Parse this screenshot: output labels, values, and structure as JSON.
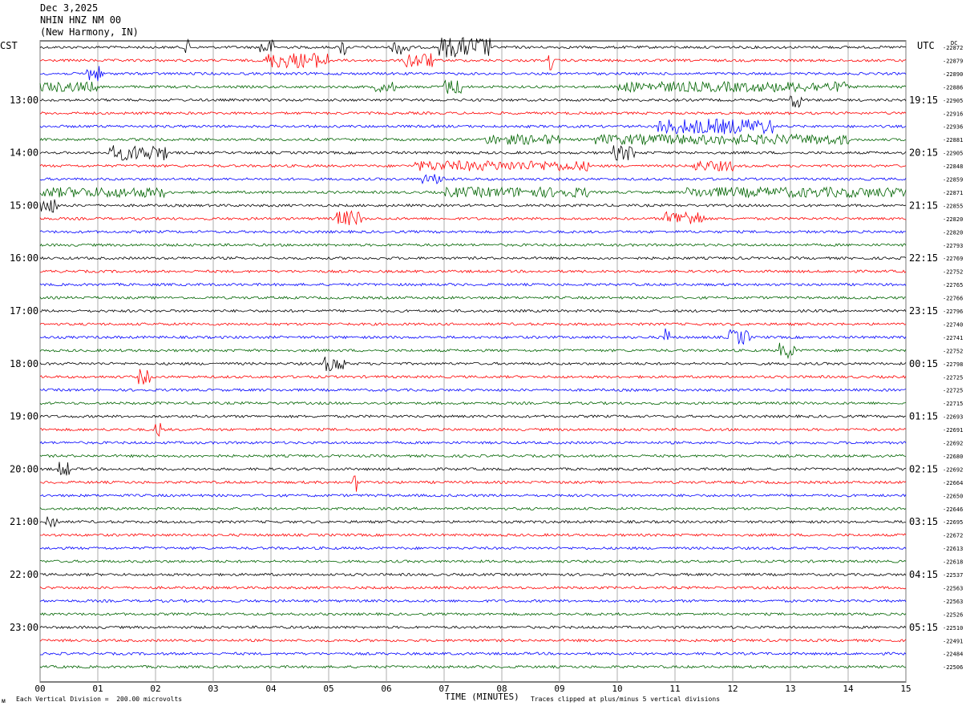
{
  "header": {
    "date": "Dec 3,2025",
    "station": "NHIN HNZ NM 00",
    "location": "(New Harmony, IN)"
  },
  "left_tz": "CST",
  "right_tz": "UTC",
  "footer": {
    "scale_note": "Each Vertical Division =  200.00 microvolts",
    "clip_note": "Traces clipped at plus/minus 5 vertical divisions",
    "corner_mark": "ᴍ"
  },
  "colors": [
    "#000000",
    "#ff0000",
    "#0000ff",
    "#006400"
  ],
  "chart_data": {
    "type": "line",
    "xlabel": "TIME (MINUTES)",
    "xlim": [
      0,
      15
    ],
    "x_ticks": [
      "00",
      "01",
      "02",
      "03",
      "04",
      "05",
      "06",
      "07",
      "08",
      "09",
      "10",
      "11",
      "12",
      "13",
      "14",
      "15"
    ],
    "left_hour_labels": [
      "13:00",
      "14:00",
      "15:00",
      "16:00",
      "17:00",
      "18:00",
      "19:00",
      "20:00",
      "21:00",
      "22:00",
      "23:00"
    ],
    "right_hour_labels": [
      "19:15",
      "20:15",
      "21:15",
      "22:15",
      "23:15",
      "00:15",
      "01:15",
      "02:15",
      "03:15",
      "04:15",
      "05:15"
    ],
    "trace_count": 48,
    "right_dc_header": "DC",
    "right_dc_values": [
      "-22872",
      "-22879",
      "-22890",
      "-22886",
      "-22905",
      "-22916",
      "-22936",
      "-22881",
      "-22905",
      "-22848",
      "-22859",
      "-22871",
      "-22855",
      "-22820",
      "-22820",
      "-22793",
      "-22769",
      "-22752",
      "-22765",
      "-22766",
      "-22796",
      "-22740",
      "-22741",
      "-22752",
      "-22798",
      "-22725",
      "-22725",
      "-22715",
      "-22693",
      "-22691",
      "-22692",
      "-22680",
      "-22692",
      "-22664",
      "-22650",
      "-22646",
      "-22695",
      "-22672",
      "-22613",
      "-22618",
      "-22537",
      "-22563",
      "-22563",
      "-22526",
      "-22510",
      "-22491",
      "-22484",
      "-22506"
    ],
    "events": [
      {
        "trace": 0,
        "x": [
          3.8,
          4.1
        ],
        "amp": 3
      },
      {
        "trace": 0,
        "x": [
          6.1,
          6.4
        ],
        "amp": 3
      },
      {
        "trace": 0,
        "x": [
          6.9,
          7.8
        ],
        "amp": 4
      },
      {
        "trace": 0,
        "x": [
          5.2,
          5.3
        ],
        "amp": 4
      },
      {
        "trace": 0,
        "x": [
          2.5,
          2.6
        ],
        "amp": 3
      },
      {
        "trace": 1,
        "x": [
          3.9,
          5.0
        ],
        "amp": 3
      },
      {
        "trace": 1,
        "x": [
          6.3,
          6.8
        ],
        "amp": 3
      },
      {
        "trace": 1,
        "x": [
          8.8,
          8.9
        ],
        "amp": 4
      },
      {
        "trace": 2,
        "x": [
          0.8,
          1.1
        ],
        "amp": 3
      },
      {
        "trace": 3,
        "x": [
          0,
          1.0
        ],
        "amp": 2
      },
      {
        "trace": 3,
        "x": [
          5.8,
          6.2
        ],
        "amp": 2
      },
      {
        "trace": 3,
        "x": [
          7.0,
          7.3
        ],
        "amp": 3
      },
      {
        "trace": 3,
        "x": [
          10.0,
          14.0
        ],
        "amp": 2
      },
      {
        "trace": 4,
        "x": [
          13.0,
          13.2
        ],
        "amp": 3
      },
      {
        "trace": 6,
        "x": [
          10.7,
          12.7
        ],
        "amp": 3
      },
      {
        "trace": 7,
        "x": [
          7.7,
          9.0
        ],
        "amp": 2
      },
      {
        "trace": 7,
        "x": [
          9.6,
          14.0
        ],
        "amp": 2
      },
      {
        "trace": 8,
        "x": [
          1.2,
          2.2
        ],
        "amp": 3
      },
      {
        "trace": 8,
        "x": [
          9.9,
          10.3
        ],
        "amp": 3
      },
      {
        "trace": 9,
        "x": [
          6.5,
          9.5
        ],
        "amp": 2
      },
      {
        "trace": 9,
        "x": [
          11.3,
          12.0
        ],
        "amp": 2
      },
      {
        "trace": 10,
        "x": [
          6.6,
          7.0
        ],
        "amp": 2
      },
      {
        "trace": 11,
        "x": [
          0,
          2.2
        ],
        "amp": 2
      },
      {
        "trace": 11,
        "x": [
          7.0,
          9.5
        ],
        "amp": 2
      },
      {
        "trace": 11,
        "x": [
          11.2,
          15.0
        ],
        "amp": 2
      },
      {
        "trace": 12,
        "x": [
          0,
          0.3
        ],
        "amp": 3
      },
      {
        "trace": 13,
        "x": [
          5.1,
          5.6
        ],
        "amp": 3
      },
      {
        "trace": 13,
        "x": [
          10.8,
          11.5
        ],
        "amp": 3
      },
      {
        "trace": 24,
        "x": [
          4.9,
          5.3
        ],
        "amp": 3
      },
      {
        "trace": 25,
        "x": [
          1.7,
          1.9
        ],
        "amp": 3
      },
      {
        "trace": 22,
        "x": [
          10.8,
          10.9
        ],
        "amp": 4
      },
      {
        "trace": 22,
        "x": [
          11.9,
          12.3
        ],
        "amp": 3
      },
      {
        "trace": 23,
        "x": [
          12.8,
          13.1
        ],
        "amp": 3
      },
      {
        "trace": 29,
        "x": [
          2.0,
          2.1
        ],
        "amp": 4
      },
      {
        "trace": 32,
        "x": [
          0.3,
          0.5
        ],
        "amp": 3
      },
      {
        "trace": 33,
        "x": [
          5.4,
          5.5
        ],
        "amp": 4
      },
      {
        "trace": 36,
        "x": [
          0.1,
          0.3
        ],
        "amp": 3
      }
    ]
  }
}
